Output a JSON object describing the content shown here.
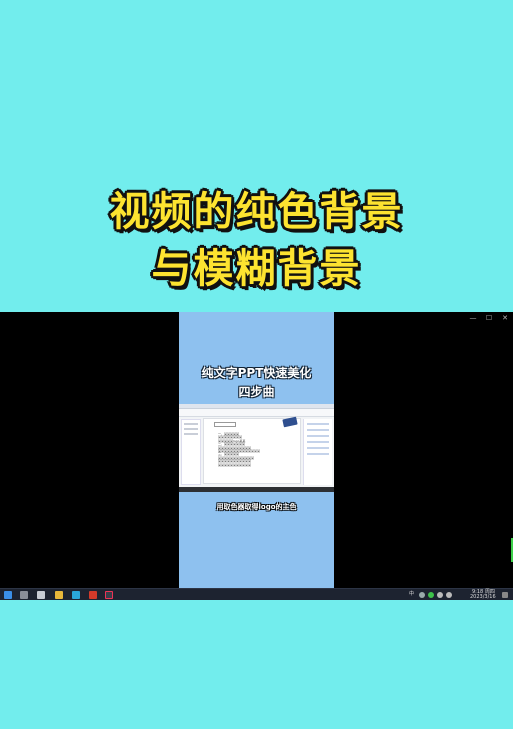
{
  "cover": {
    "title_line1": "视频的纯色背景",
    "title_line2": "与模糊背景"
  },
  "screen": {
    "window_controls": [
      "—",
      "☐",
      "✕"
    ],
    "phone": {
      "title_line1": "纯文字PPT快速美化",
      "title_line2": "四步曲",
      "subtitle": "用取色器取得logo的主色",
      "document_lines": [
        "一、某某某某某",
        "某某某某某某某某",
        "某某某某某logo某某",
        "二、某某某某某某某",
        "某某某某某某某某某某某",
        "某某某某某某某某某某某某某某",
        "三、某某某某某",
        "某某某某某某某某某某某某",
        "某某某某某某某某某某某",
        "某某某某某某某某某某某"
      ]
    },
    "taskbar": {
      "tray_lang": "中",
      "clock_time": "9:18 周四",
      "clock_date": "2023/3/16"
    }
  },
  "colors": {
    "background": "#72eded",
    "title_fill": "#fde330",
    "phone_background": "#8ec1ef",
    "taskbar": "#1d2330"
  }
}
